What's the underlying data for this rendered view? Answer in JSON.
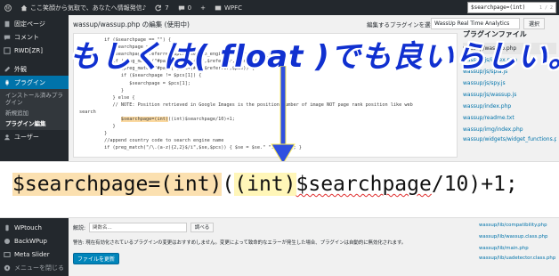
{
  "adminbar": {
    "site_title": "ここ笑顔から気取で、あなたへ情報発信♪",
    "updates": "7",
    "comments": "0",
    "new": "+",
    "plugin": "WPFC",
    "find_query": "$searchpage=(int)",
    "find_count": "1 / 2"
  },
  "sidebar": {
    "items_top": [
      {
        "label": "固定ページ"
      },
      {
        "label": "コメント"
      },
      {
        "label": "RWD[ZR]"
      }
    ],
    "appearance": "外観",
    "plugins": "プラグイン",
    "plugins_sub": [
      "インストール済みプラグイン",
      "新規追加",
      "プラグイン編集"
    ],
    "users": "ユーザー",
    "items_bottom": [
      {
        "label": "WPtouch"
      },
      {
        "label": "BackWPup"
      },
      {
        "label": "Meta Slider"
      },
      {
        "label": "メニューを閉じる"
      }
    ]
  },
  "header": {
    "title": "wassup/wassup.php の編集 (使用中)",
    "select_label": "編集するプラグインを選択:",
    "select_value": "WassUp Real Time Analytics",
    "select_button": "選択"
  },
  "editor": {
    "lines": [
      "         if ($searchpage == \"\") {",
      "            $searchpage = \"\";",
      "            $searchpage=$referrer;$pcs=$search_engine;$se=$referrer_search;",
      "            if (preg_match(\"#page[=]([^&]+)#\",$referrer,$pcs)) {",
      "            if (preg_match(\"#page[=](\\d+)#i\",$referrer,$pcs)) {",
      "               if ($searchpage != $pcs[1]) {",
      "                  $searchpage = $pcs[1];",
      "               }",
      "            } else {",
      "            // NOTE: Position retrieved in Google Images is the position number of image NOT page rank position like web",
      "search",
      "               $searchpage=(int)((int)$searchpage/10)+1;",
      "            }",
      "         }",
      "         //append country code to search engine name",
      "         if (preg_match(\"/\\.(a-z){2,2}$/i\",$se,$pcs)) { $se = $se.\" \".$pcs[1]; }"
    ],
    "hl_text": "$searchpage=(int)",
    "hl_rest": "((int)$searchpage/10)+1;"
  },
  "files": {
    "heading": "プラグインファイル",
    "items": [
      "wassup/wassup.php",
      "wassup/js/index.php",
      "wassup/js/spia.js",
      "wassup/js/spy.js",
      "wassup/js/wassup.js",
      "wassup/index.php",
      "wassup/readme.txt",
      "wassup/img/index.php",
      "wassup/widgets/widget_functions.php"
    ],
    "current": 0,
    "bottom_items": [
      "wassup/lib/compatibility.php",
      "wassup/lib/wassup.class.php",
      "wassup/lib/main.php",
      "wassup/lib/uadetector.class.php"
    ]
  },
  "overlay": {
    "title": "もしくは( float )でも良いらしい。"
  },
  "zoom": {
    "part1": "$searchpage=(int)",
    "part2": "(",
    "part3": "(int)",
    "part4": "$searchpage",
    "part5": "/10)+1;"
  },
  "bottom": {
    "doc_label": "解説:",
    "doc_select": "関数名...",
    "doc_button": "調べる",
    "warning": "警告: 現在有効化されているプラグインの変更はおすすめしません。変更によって致命的なエラーが発生した場合、プラグインは自動的に無効化されます。",
    "update_button": "ファイルを更新"
  },
  "colors": {
    "adminbar": "#23282d",
    "active": "#0073aa",
    "title": "#1030d0",
    "arrow": "#3050e0"
  }
}
